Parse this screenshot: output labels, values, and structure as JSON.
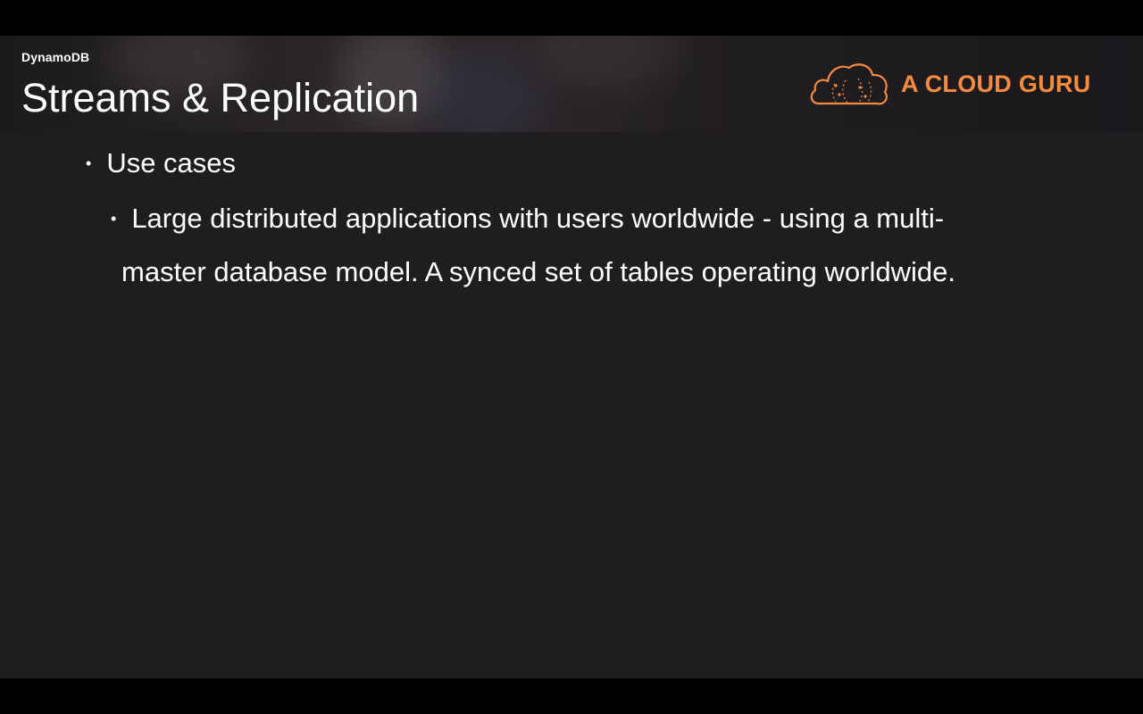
{
  "header": {
    "section_label": "DynamoDB",
    "title": "Streams & Replication"
  },
  "logo": {
    "icon": "cloud-icon",
    "text": "A CLOUD GURU",
    "color": "#f48b40"
  },
  "content": {
    "bullets": [
      {
        "text": "Use cases",
        "children": [
          {
            "line1": "Large distributed applications with users worldwide - using a multi-",
            "line2": "master database model. A synced set of tables operating worldwide."
          }
        ]
      }
    ]
  },
  "colors": {
    "slide_background": "#1f1d20",
    "letterbox": "#000000",
    "text": "#ffffff",
    "accent": "#f48b40"
  }
}
